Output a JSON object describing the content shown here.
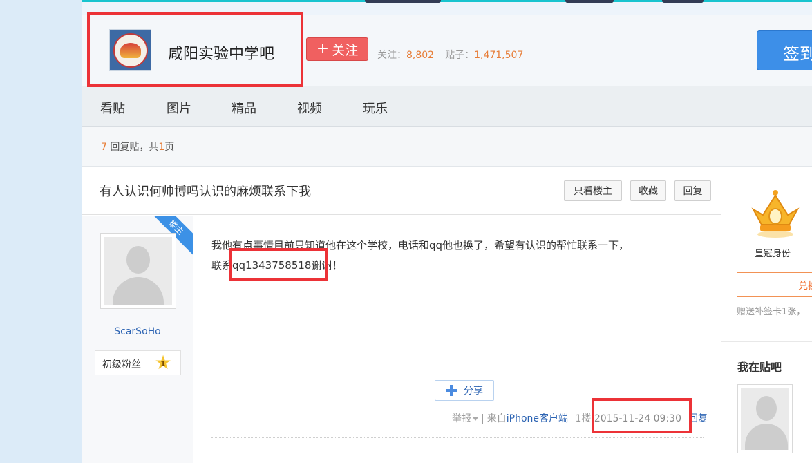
{
  "forum": {
    "name": "咸阳实验中学吧",
    "follow_label": "关注",
    "follow_prefix": "+",
    "followers_label": "关注：",
    "followers": "8,802",
    "posts_label": "贴子：",
    "posts": "1,471,507",
    "sign_label": "签到"
  },
  "nav": {
    "items": [
      "看贴",
      "图片",
      "精品",
      "视频",
      "玩乐"
    ]
  },
  "reply_bar": {
    "count": "7",
    "text_mid": " 回复贴，共",
    "pages": "1",
    "text_end": "页"
  },
  "thread": {
    "title": "有人认识何帅博吗认识的麻烦联系下我",
    "btn_op_only": "只看楼主",
    "btn_collect": "收藏",
    "btn_reply": "回复"
  },
  "post": {
    "ribbon": "楼主",
    "username": "ScarSoHo",
    "fan_level_label": "初级粉丝",
    "fan_level": "1",
    "content_line1": "我他有点事情目前只知道他在这个学校，电话和qq他也换了，希望有认识的帮忙联系一下，",
    "content_line2": "联系qq1343758518谢谢！",
    "share_label": "分享",
    "report_label": "举报",
    "source_prefix": "来自",
    "source_client": "iPhone客户端",
    "floor": "1楼",
    "date": "2015-11-24 09:30",
    "reply_label": "回复"
  },
  "sidebar": {
    "crown_label": "皇冠身份",
    "exchange_label": "兑换",
    "gift_text": "赠送补签卡1张，",
    "my_bars_title": "我在贴吧"
  },
  "colors": {
    "accent_blue": "#3d8fe8",
    "follow_red": "#f06060",
    "highlight_red": "#ec3237",
    "number_orange": "#e77d37"
  }
}
